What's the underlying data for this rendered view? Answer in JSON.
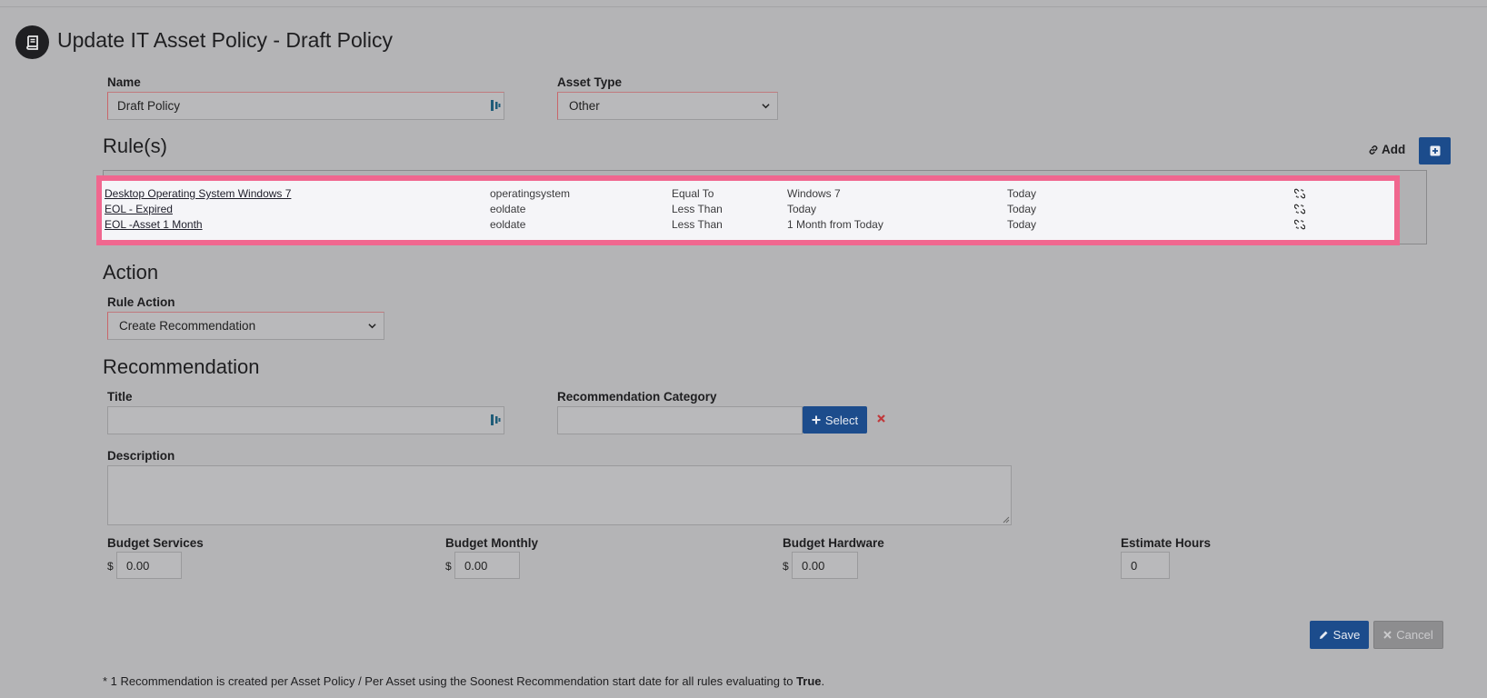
{
  "page": {
    "title": "Update IT Asset Policy - Draft Policy",
    "icon": "book-icon"
  },
  "form": {
    "name_label": "Name",
    "name_value": "Draft Policy",
    "asset_type_label": "Asset Type",
    "asset_type_value": "Other"
  },
  "rules": {
    "section_title": "Rule(s)",
    "add_label": "Add",
    "rows": [
      {
        "name": "Desktop Operating System Windows 7",
        "field": "operatingsystem",
        "operator": "Equal To",
        "value": "Windows 7",
        "start": "Today"
      },
      {
        "name": "EOL - Expired",
        "field": "eoldate",
        "operator": "Less Than",
        "value": "Today",
        "start": "Today"
      },
      {
        "name": "EOL -Asset 1 Month",
        "field": "eoldate",
        "operator": "Less Than",
        "value": "1 Month from Today",
        "start": "Today"
      }
    ]
  },
  "action": {
    "section_title": "Action",
    "rule_action_label": "Rule Action",
    "rule_action_value": "Create Recommendation"
  },
  "recommendation": {
    "section_title": "Recommendation",
    "title_label": "Title",
    "title_value": "",
    "category_label": "Recommendation Category",
    "category_value": "",
    "select_label": "Select",
    "description_label": "Description",
    "description_value": ""
  },
  "budget": {
    "currency": "$",
    "services_label": "Budget Services",
    "services_value": "0.00",
    "monthly_label": "Budget Monthly",
    "monthly_value": "0.00",
    "hardware_label": "Budget Hardware",
    "hardware_value": "0.00",
    "hours_label": "Estimate Hours",
    "hours_value": "0"
  },
  "buttons": {
    "save_label": "Save",
    "cancel_label": "Cancel"
  },
  "footnote": {
    "text": "* 1 Recommendation is created per Asset Policy / Per Asset using the Soonest Recommendation start date for all rules evaluating to ",
    "emphasis": "True",
    "end": "."
  },
  "colors": {
    "primary": "#1c4c8c",
    "highlight": "#f0678f",
    "danger": "#c0393b"
  }
}
